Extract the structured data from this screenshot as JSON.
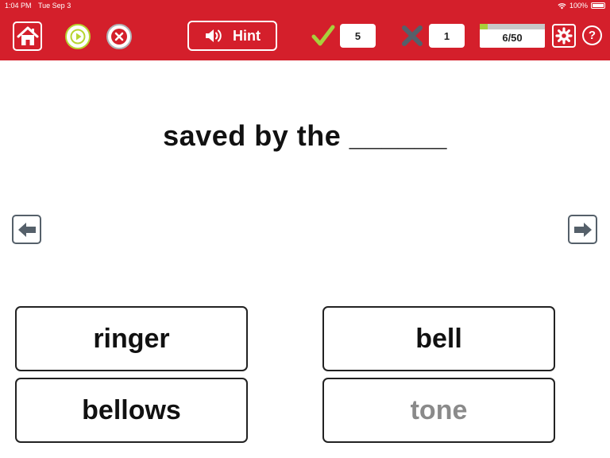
{
  "status_bar": {
    "time": "1:04 PM",
    "date": "Tue Sep 3",
    "battery": "100%"
  },
  "toolbar": {
    "hint_label": "Hint",
    "correct_count": "5",
    "wrong_count": "1",
    "progress_text": "6/50",
    "progress_fraction": 0.12,
    "help_label": "?"
  },
  "question": {
    "text": "saved by the ______"
  },
  "answers": [
    {
      "label": "ringer",
      "enabled": true
    },
    {
      "label": "bell",
      "enabled": true
    },
    {
      "label": "bellows",
      "enabled": true
    },
    {
      "label": "tone",
      "enabled": false
    }
  ],
  "colors": {
    "header_red": "#d41f2b",
    "accent_green": "#b7d530",
    "cancel_grey": "#b0b4b8",
    "check_green": "#a8cf3c",
    "wrong_grey": "#55606a",
    "disabled_text": "#8a8a8a"
  },
  "icons": {
    "home": "home-icon",
    "play": "play-icon",
    "stop": "close-icon",
    "hint": "speaker-icon",
    "correct": "checkmark-icon",
    "wrong": "x-mark-icon",
    "settings": "gear-icon",
    "help": "help-icon",
    "prev": "arrow-left-icon",
    "next": "arrow-right-icon"
  }
}
